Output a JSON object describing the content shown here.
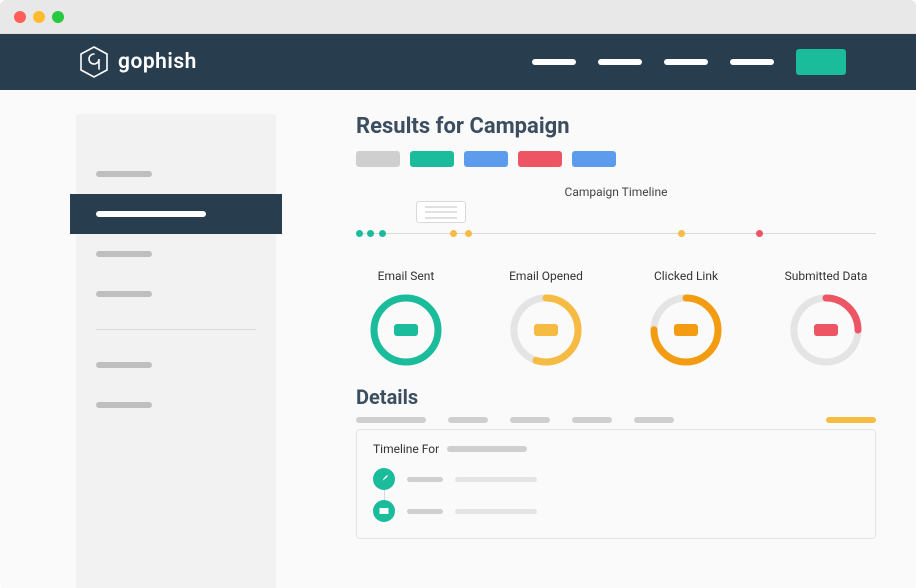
{
  "brand": {
    "name": "gophish"
  },
  "page": {
    "title": "Results for Campaign",
    "timeline_label": "Campaign Timeline",
    "details_title": "Details",
    "timeline_for": "Timeline For"
  },
  "action_buttons": [
    {
      "color": "gray"
    },
    {
      "color": "green"
    },
    {
      "color": "blue"
    },
    {
      "color": "red"
    },
    {
      "color": "blue"
    }
  ],
  "stats": [
    {
      "label": "Email Sent",
      "color": "#1abc9c",
      "percent": 100
    },
    {
      "label": "Email Opened",
      "color": "#f6bb42",
      "percent": 55
    },
    {
      "label": "Clicked Link",
      "color": "#f39c12",
      "percent": 75
    },
    {
      "label": "Submitted Data",
      "color": "#ed5565",
      "percent": 25
    }
  ],
  "timeline_points": [
    {
      "pos": 0,
      "color": "green"
    },
    {
      "pos": 2.2,
      "color": "green"
    },
    {
      "pos": 4.4,
      "color": "green"
    },
    {
      "pos": 18,
      "color": "orange"
    },
    {
      "pos": 21,
      "color": "orange"
    },
    {
      "pos": 62,
      "color": "orange"
    },
    {
      "pos": 77,
      "color": "red"
    }
  ],
  "detail_header_widths": [
    70,
    40,
    40,
    40,
    40,
    50
  ],
  "colors": {
    "navy": "#283e4f",
    "teal": "#1abc9c",
    "blue": "#5d9cec",
    "red": "#ed5565",
    "orange": "#f6bb42"
  }
}
